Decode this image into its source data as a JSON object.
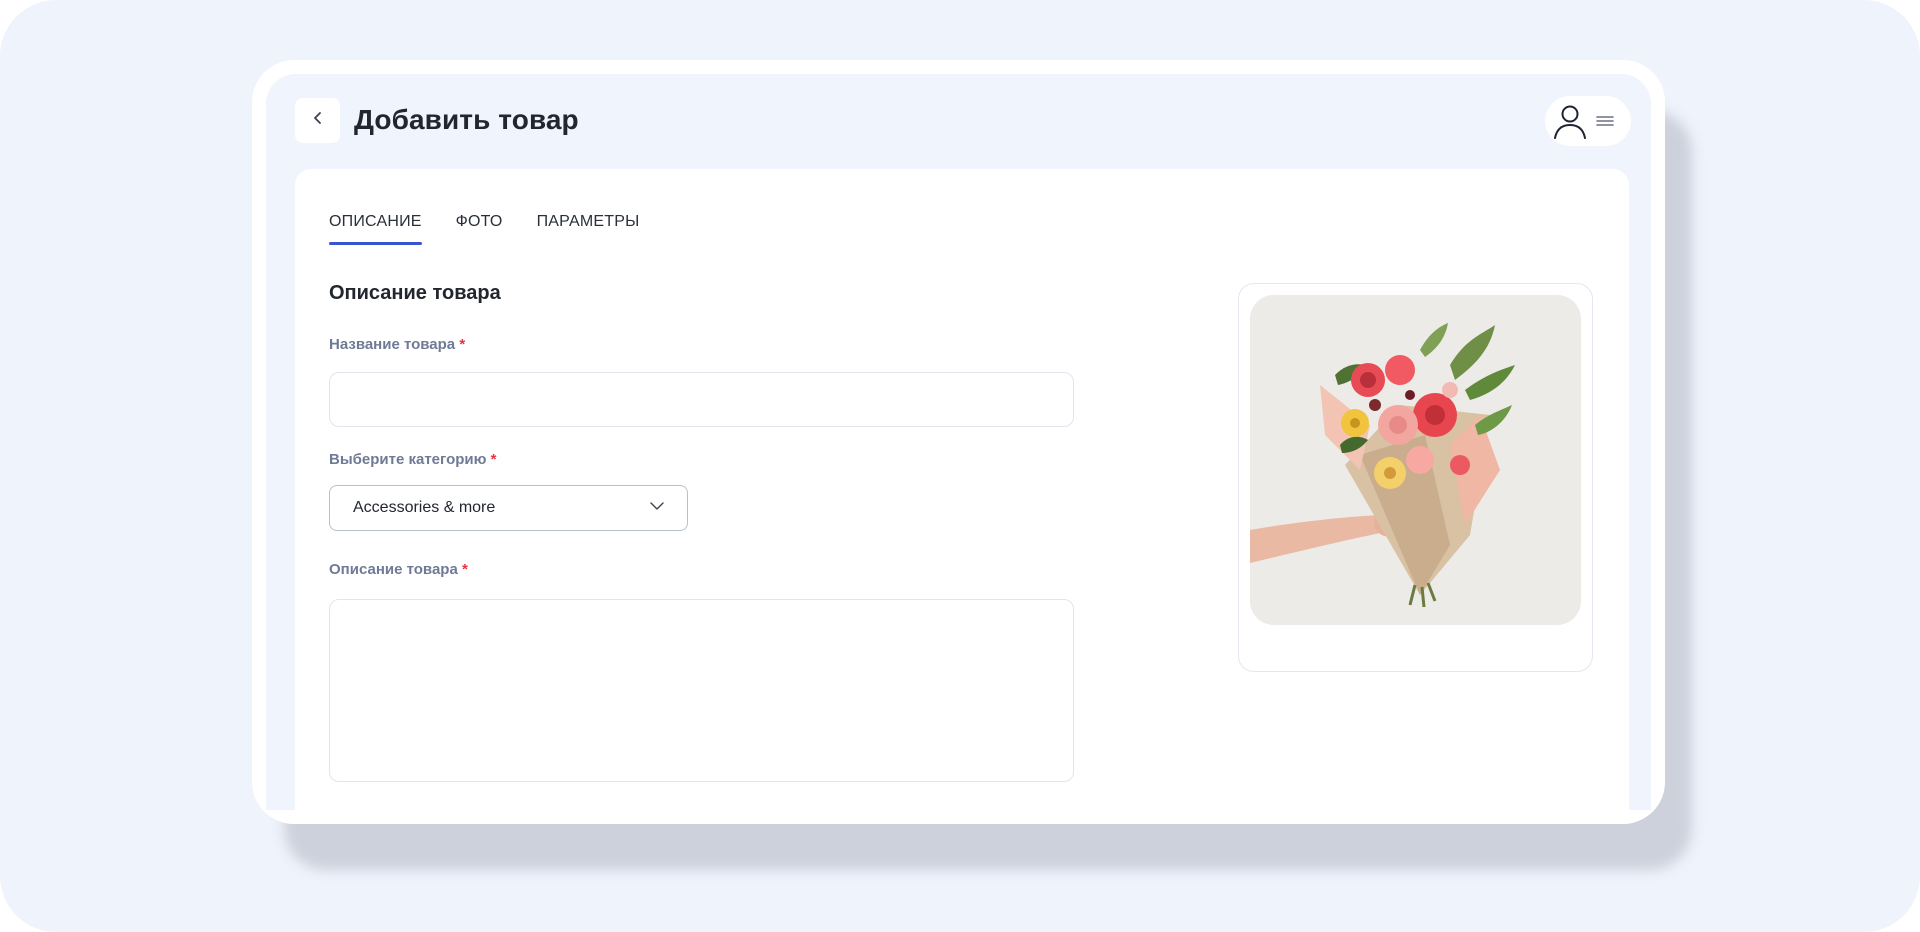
{
  "header": {
    "title": "Добавить товар",
    "back_icon": "chevron-left-icon",
    "user_icon": "user-icon",
    "menu_icon": "hamburger-menu-icon"
  },
  "tabs": [
    {
      "label": "ОПИСАНИЕ",
      "active": true
    },
    {
      "label": "ФОТО",
      "active": false
    },
    {
      "label": "ПАРАМЕТРЫ",
      "active": false
    }
  ],
  "form": {
    "section_title": "Описание товара",
    "name_field": {
      "label": "Название товара",
      "required_mark": "*",
      "value": ""
    },
    "category_field": {
      "label": "Выберите категорию",
      "required_mark": "*",
      "selected": "Accessories & more"
    },
    "description_field": {
      "label": "Описание товара",
      "required_mark": "*",
      "value": ""
    }
  },
  "photo": {
    "subject": "flower bouquet held in hand"
  },
  "colors": {
    "accent": "#3a54d0",
    "required": "#e5333f",
    "label": "#6f7a96",
    "background": "#eef3fc"
  }
}
